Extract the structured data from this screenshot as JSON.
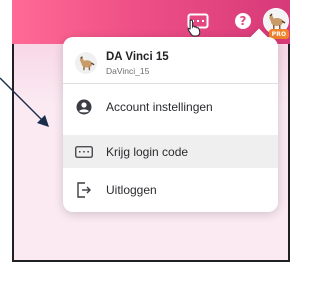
{
  "menu": {
    "user": {
      "name": "DA Vinci 15",
      "handle": "DaVinci_15"
    },
    "items": [
      {
        "label": "Account instellingen",
        "icon": "account-circle-icon"
      },
      {
        "label": "Krijg login code",
        "icon": "keyboard-icon",
        "hovered": true
      },
      {
        "label": "Uitloggen",
        "icon": "logout-icon"
      }
    ]
  },
  "header": {
    "help_glyph": "?",
    "pro_badge": "PRO",
    "icons": [
      "keyboard-icon",
      "help-icon",
      "avatar"
    ]
  },
  "colors": {
    "topbar_start": "#ff6a95",
    "topbar_end": "#d63a78",
    "panel_bg": "#fbeaf2",
    "pro_badge": "#f0832b",
    "hover_bg": "#efefef"
  }
}
